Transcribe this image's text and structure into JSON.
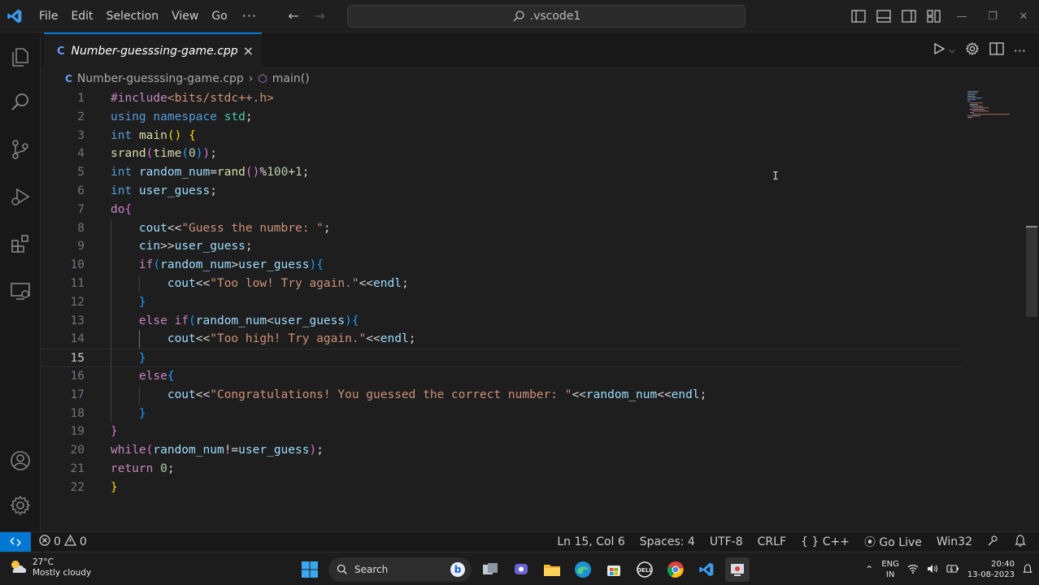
{
  "titlebar": {
    "menu": [
      "File",
      "Edit",
      "Selection",
      "View",
      "Go"
    ],
    "more": "···",
    "search_text": ".vscode1"
  },
  "tab": {
    "label": "Number-guesssing-game.cpp",
    "icon": "C",
    "close": "×"
  },
  "breadcrumb": {
    "file": "Number-guesssing-game.cpp",
    "symbol": "main()"
  },
  "editor": {
    "current_line": 15,
    "lines": [
      "#include<bits/stdc++.h>",
      "using namespace std;",
      "int main() {",
      "srand(time(0));",
      "int random_num=rand()%100+1;",
      "int user_guess;",
      "do{",
      "    cout<<\"Guess the numbre: \";",
      "    cin>>user_guess;",
      "    if(random_num>user_guess){",
      "        cout<<\"Too low! Try again.\"<<endl;",
      "    }",
      "    else if(random_num<user_guess){",
      "        cout<<\"Too high! Try again.\"<<endl;",
      "    }",
      "    else{",
      "        cout<<\"Congratulations! You guessed the correct number: \"<<random_num<<endl;",
      "    }",
      "}",
      "while(random_num!=user_guess);",
      "return 0;",
      "}"
    ]
  },
  "statusbar": {
    "errors": "0",
    "warnings": "0",
    "position": "Ln 15, Col 6",
    "spaces": "Spaces: 4",
    "encoding": "UTF-8",
    "eol": "CRLF",
    "language_braces": "{ }",
    "language": "C++",
    "golive": "Go Live",
    "platform": "Win32"
  },
  "taskbar": {
    "temperature": "27°C",
    "weather": "Mostly cloudy",
    "search": "Search",
    "lang_top": "ENG",
    "lang_bottom": "IN",
    "time": "20:40",
    "date": "13-08-2023"
  },
  "colors": {
    "accent": "#0078d4",
    "keyword": "#569cd6",
    "control": "#c586c0",
    "function": "#dcdcaa",
    "variable": "#9cdcfe",
    "string": "#ce9178",
    "number": "#b5cea8"
  }
}
